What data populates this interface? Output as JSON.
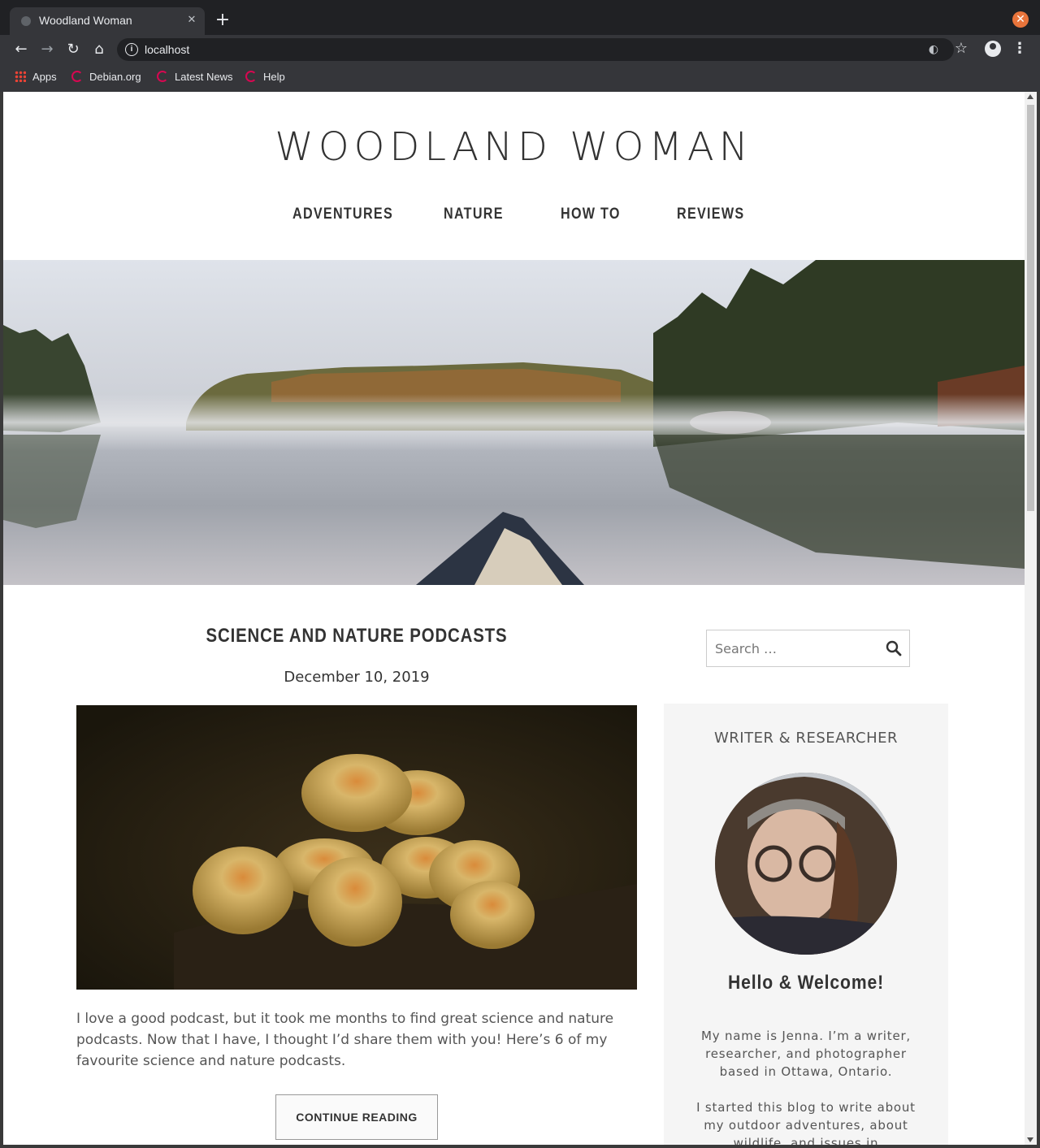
{
  "browser": {
    "tab_title": "Woodland Woman",
    "url": "localhost",
    "bookmarks": [
      "Apps",
      "Debian.org",
      "Latest News",
      "Help"
    ]
  },
  "site": {
    "title": "WOODLAND WOMAN",
    "nav": [
      "ADVENTURES",
      "NATURE",
      "HOW TO",
      "REVIEWS"
    ]
  },
  "post": {
    "title": "SCIENCE AND NATURE PODCASTS",
    "date": "December 10, 2019",
    "excerpt": "I love a good podcast, but it took me months to find great science and nature podcasts. Now that I have, I thought I’d share them with you! Here’s 6 of my favourite science and nature podcasts.",
    "continue_label": "CONTINUE READING"
  },
  "sidebar": {
    "search_placeholder": "Search …",
    "about_heading": "WRITER & RESEARCHER",
    "welcome": "Hello & Welcome!",
    "about_p1": "My name is Jenna. I’m a writer, researcher, and photographer based in Ottawa, Ontario.",
    "about_p2": "I started this blog to write about my outdoor adventures, about wildlife, and issues in"
  },
  "colors": {
    "accent_close": "#e8743b",
    "text_dark": "#333333",
    "panel_bg": "#f5f5f5"
  }
}
